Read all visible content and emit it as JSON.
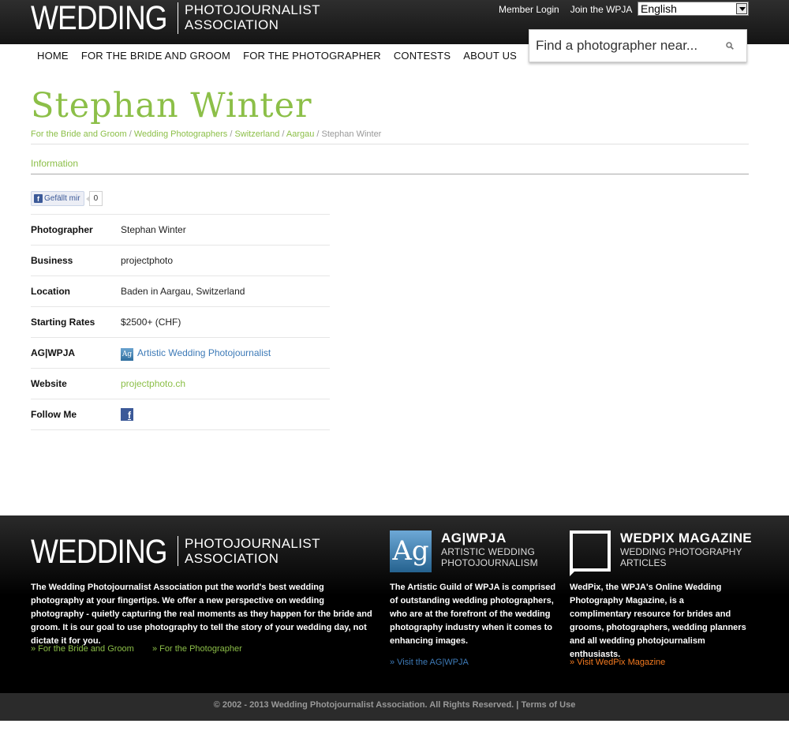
{
  "header": {
    "logo_big": "WEDDING",
    "logo_line1": "PHOTOJOURNALIST",
    "logo_line2": "ASSOCIATION",
    "member_login": "Member Login",
    "join": "Join the WPJA",
    "language": "English",
    "search_placeholder": "Find a photographer near..."
  },
  "nav": [
    "HOME",
    "FOR THE BRIDE AND GROOM",
    "FOR THE PHOTOGRAPHER",
    "CONTESTS",
    "ABOUT US"
  ],
  "page": {
    "title": "Stephan Winter",
    "breadcrumb": [
      "For the Bride and Groom",
      "Wedding Photographers",
      "Switzerland",
      "Aargau"
    ],
    "breadcrumb_current": "Stephan Winter",
    "section": "Information",
    "fb_like": "Gefällt mir",
    "fb_count": "0"
  },
  "info": {
    "photographer_label": "Photographer",
    "photographer": "Stephan Winter",
    "business_label": "Business",
    "business": "projectphoto",
    "location_label": "Location",
    "location": "Baden in Aargau, Switzerland",
    "rates_label": "Starting Rates",
    "rates": "$2500+ (CHF)",
    "ag_label": "AG|WPJA",
    "ag_value": "Artistic Wedding Photojournalist",
    "website_label": "Website",
    "website": "projectphoto.ch",
    "follow_label": "Follow Me"
  },
  "footer": {
    "wpja_text": "The Wedding Photojournalist Association put the world's best wedding photography at your fingertips. We offer a new perspective on wedding photography - quietly capturing the real moments as they happen for the bride and groom. It is our goal to use photography to tell the story of your wedding day, not dictate it for you.",
    "link_bride": "» For the Bride and Groom",
    "link_photographer": "» For the Photographer",
    "ag_title": "AG|WPJA",
    "ag_sub1": "ARTISTIC WEDDING",
    "ag_sub2": "PHOTOJOURNALISM",
    "ag_text": "The Artistic Guild of WPJA is comprised of outstanding wedding photographers, who are at the forefront of the wedding photography industry when it comes to enhancing images.",
    "ag_link": "» Visit the AG|WPJA",
    "wp_title": "WEDPIX MAGAZINE",
    "wp_sub1": "WEDDING PHOTOGRAPHY",
    "wp_sub2": "ARTICLES",
    "wp_text": "WedPix, the WPJA's Online Wedding Photography Magazine, is a complimentary resource for brides and grooms, photographers, wedding planners and all wedding photojournalism enthusiasts.",
    "wp_link": "» Visit WedPix Magazine",
    "copyright": "© 2002 - 2013 Wedding Photojournalist Association. All Rights Reserved. |",
    "terms": "Terms of Use"
  },
  "colors": {
    "green": "#8cbf48",
    "blue": "#3d7ab7",
    "orange": "#f47a20"
  }
}
